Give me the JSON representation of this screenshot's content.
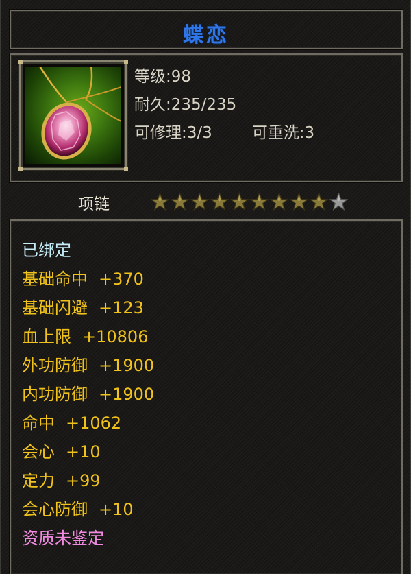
{
  "item": {
    "name": "蝶恋",
    "icon": "pink-gem-necklace-icon",
    "level_line": "等级:98",
    "durability_line": "耐久:235/235",
    "repairable_line": "可修理:3/3",
    "rewash_line": "可重洗:3",
    "type": "项链",
    "stars_filled": 9,
    "stars_total": 10,
    "bound_text": "已绑定",
    "attributes": [
      {
        "label": "基础命中",
        "value": "+370"
      },
      {
        "label": "基础闪避",
        "value": "+123"
      },
      {
        "label": "血上限",
        "value": "+10806"
      },
      {
        "label": "外功防御",
        "value": "+1900"
      },
      {
        "label": "内功防御",
        "value": "+1900"
      },
      {
        "label": "命中",
        "value": "+1062"
      },
      {
        "label": "会心",
        "value": "+10"
      },
      {
        "label": "定力",
        "value": "+99"
      },
      {
        "label": "会心防御",
        "value": "+10"
      }
    ],
    "quality_text": "资质未鉴定"
  },
  "colors": {
    "title": "#2f76e8",
    "attribute": "#f0c21b",
    "bound": "#c6ecf8",
    "quality": "#f08be0",
    "star_filled": "#8a7a3a",
    "star_empty": "#9a9a9a"
  }
}
